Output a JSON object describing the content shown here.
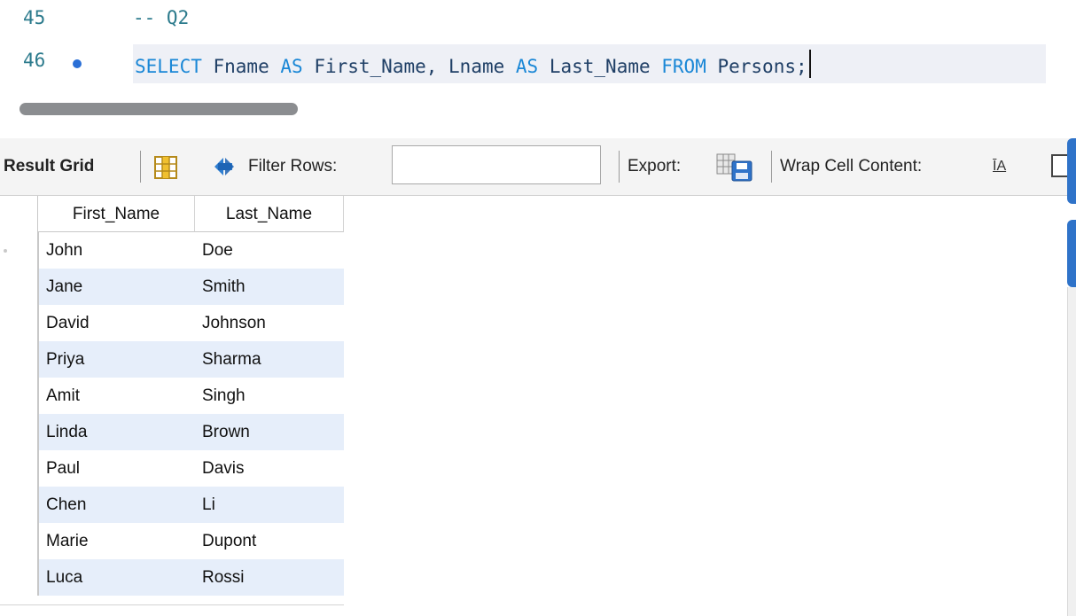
{
  "editor": {
    "lines": [
      {
        "number": "45",
        "comment": "-- Q2"
      },
      {
        "number": "46",
        "tokens": {
          "k1": "SELECT",
          "t1": " Fname ",
          "k2": "AS",
          "t2": " First_Name, Lname ",
          "k3": "AS",
          "t3": " Last_Name ",
          "k4": "FROM",
          "t4": " Persons;"
        }
      }
    ]
  },
  "toolbar": {
    "result_grid_label": "Result Grid",
    "filter_rows_label": "Filter Rows:",
    "filter_value": "",
    "export_label": "Export:",
    "wrap_label": "Wrap Cell Content:",
    "wrap_icon_text": "ĪA"
  },
  "grid": {
    "columns": [
      "First_Name",
      "Last_Name"
    ],
    "rows": [
      [
        "John",
        "Doe"
      ],
      [
        "Jane",
        "Smith"
      ],
      [
        "David",
        "Johnson"
      ],
      [
        "Priya",
        "Sharma"
      ],
      [
        "Amit",
        "Singh"
      ],
      [
        "Linda",
        "Brown"
      ],
      [
        "Paul",
        "Davis"
      ],
      [
        "Chen",
        "Li"
      ],
      [
        "Marie",
        "Dupont"
      ],
      [
        "Luca",
        "Rossi"
      ]
    ]
  },
  "colors": {
    "keyword": "#1a87d6",
    "line_number": "#2b7a8c",
    "alt_row": "#e6eefa",
    "accent": "#2f73c9"
  },
  "icons": [
    "grid-view-icon",
    "refresh-icon",
    "export-save-icon",
    "wrap-text-icon",
    "checkbox-icon"
  ]
}
